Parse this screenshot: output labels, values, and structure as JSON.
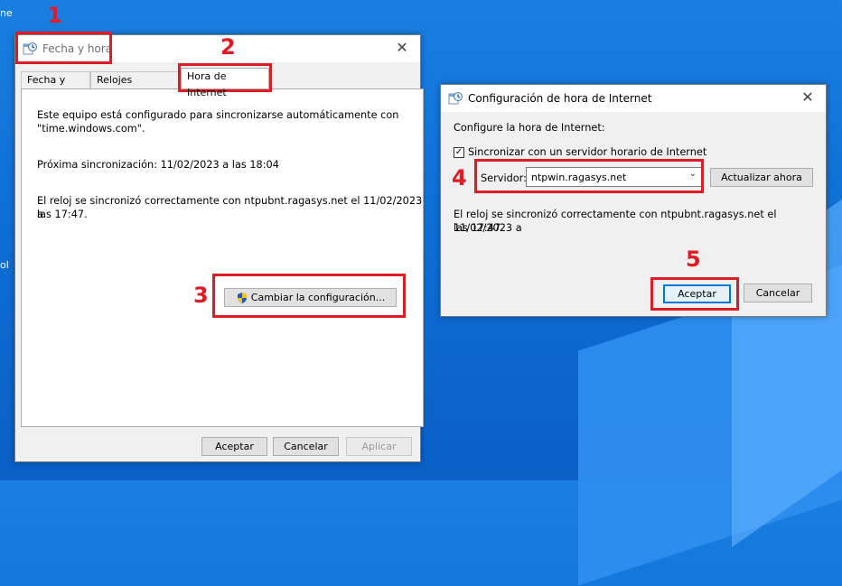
{
  "desktop": {
    "label_top": "ne",
    "label_mid": "ol"
  },
  "main_window": {
    "title": "Fecha y hora",
    "tabs": [
      "Fecha y hora",
      "Relojes adicionales",
      "Hora de Internet"
    ],
    "line1": "Este equipo está configurado para sincronizarse automáticamente con",
    "line2": "\"time.windows.com\".",
    "next_sync": "Próxima sincronización: 11/02/2023 a las 18:04",
    "sync_line1": "El reloj se sincronizó correctamente con ntpubnt.ragasys.net el 11/02/2023 a",
    "sync_line2": "las 17:47.",
    "change_button": "Cambiar la configuración...",
    "accept": "Aceptar",
    "cancel": "Cancelar",
    "apply": "Aplicar"
  },
  "dialog": {
    "title": "Configuración de hora de Internet",
    "heading": "Configure la hora de Internet:",
    "checkbox_label": "Sincronizar con un servidor horario de Internet",
    "checkbox_checked": true,
    "server_label": "Servidor:",
    "server_value": "ntpwin.ragasys.net",
    "update_button": "Actualizar ahora",
    "sync_line1": "El reloj se sincronizó correctamente con ntpubnt.ragasys.net el 11/02/2023 a",
    "sync_line2": "las 17:47.",
    "accept": "Aceptar",
    "cancel": "Cancelar"
  },
  "annotations": {
    "n1": "1",
    "n2": "2",
    "n3": "3",
    "n4": "4",
    "n5": "5"
  },
  "colors": {
    "highlight_red": "#e11b24",
    "accent": "#0078d7",
    "desktop_blue": "#0e6fd6"
  }
}
